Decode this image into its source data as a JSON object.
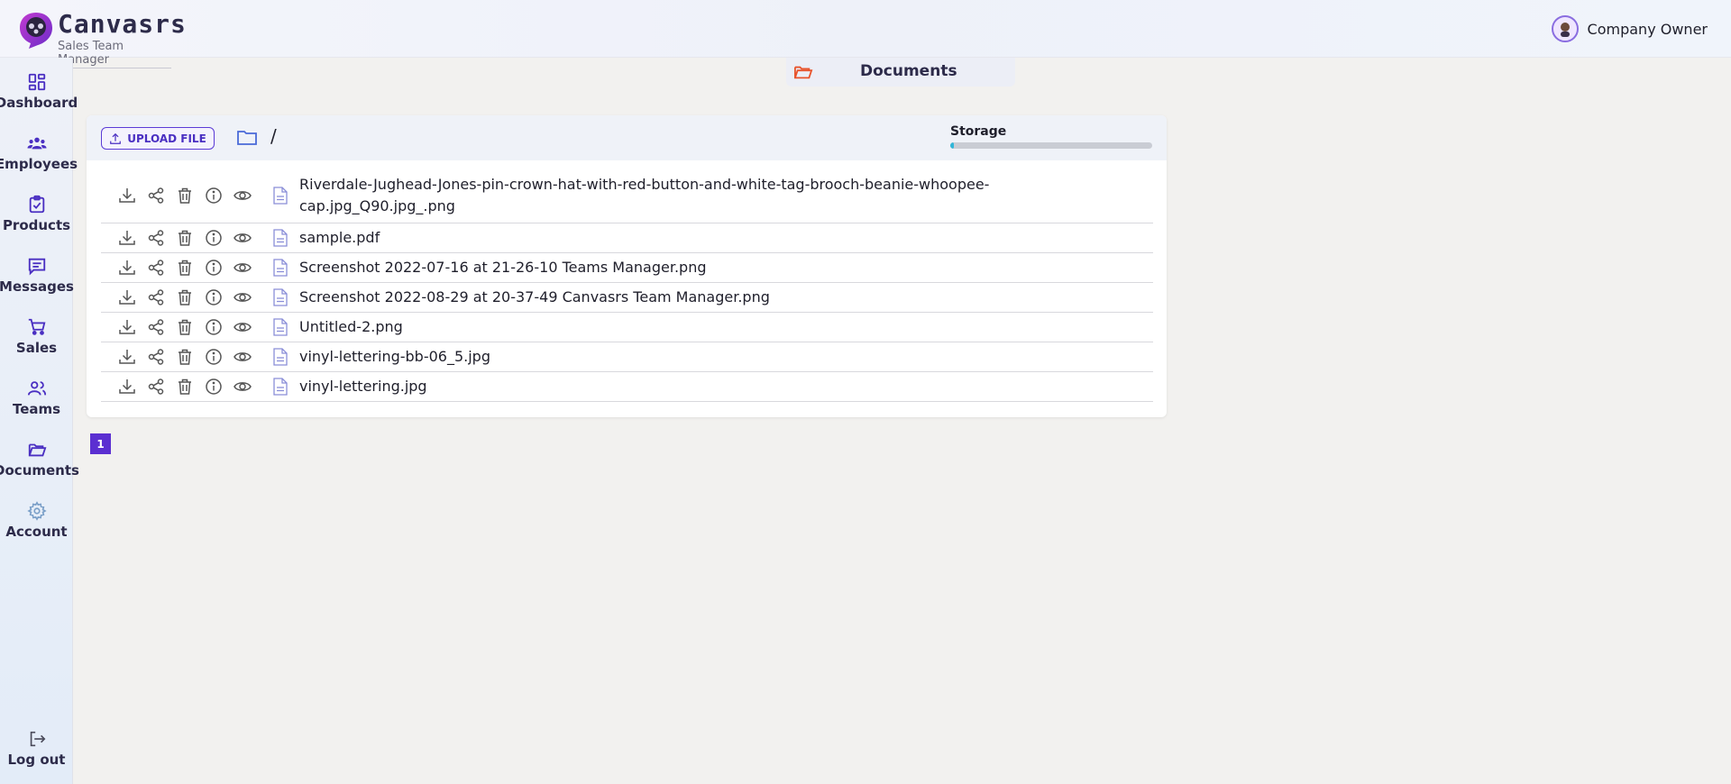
{
  "app": {
    "name": "Canvasrs",
    "subtitle": "Sales Team Manager"
  },
  "user": {
    "name": "Company Owner"
  },
  "sidebar": {
    "items": [
      {
        "label": "Dashboard",
        "icon": "dashboard-icon"
      },
      {
        "label": "Employees",
        "icon": "employees-icon"
      },
      {
        "label": "Products",
        "icon": "products-icon"
      },
      {
        "label": "Messages",
        "icon": "messages-icon"
      },
      {
        "label": "Sales",
        "icon": "cart-icon"
      },
      {
        "label": "Teams",
        "icon": "teams-icon"
      },
      {
        "label": "Documents",
        "icon": "folder-icon"
      },
      {
        "label": "Account",
        "icon": "gear-icon"
      }
    ],
    "logout": "Log out"
  },
  "page_tab": {
    "label": "Documents"
  },
  "toolbar": {
    "upload_label": "UPLOAD FILE",
    "path": "/",
    "storage_label": "Storage",
    "storage_used_fraction": 0.02
  },
  "files": [
    {
      "name": "Riverdale-Jughead-Jones-pin-crown-hat-with-red-button-and-white-tag-brooch-beanie-whoopee-cap.jpg_Q90.jpg_.png"
    },
    {
      "name": "sample.pdf"
    },
    {
      "name": "Screenshot 2022-07-16 at 21-26-10 Teams Manager.png"
    },
    {
      "name": "Screenshot 2022-08-29 at 20-37-49 Canvasrs Team Manager.png"
    },
    {
      "name": "Untitled-2.png"
    },
    {
      "name": "vinyl-lettering-bb-06_5.jpg"
    },
    {
      "name": "vinyl-lettering.jpg"
    }
  ],
  "pagination": {
    "current": "1"
  },
  "colors": {
    "accent": "#5b2fd1",
    "nav_icon": "#4a2fc2",
    "storage_fill": "#31b6d8",
    "folder_tab_icon": "#e8542c"
  }
}
